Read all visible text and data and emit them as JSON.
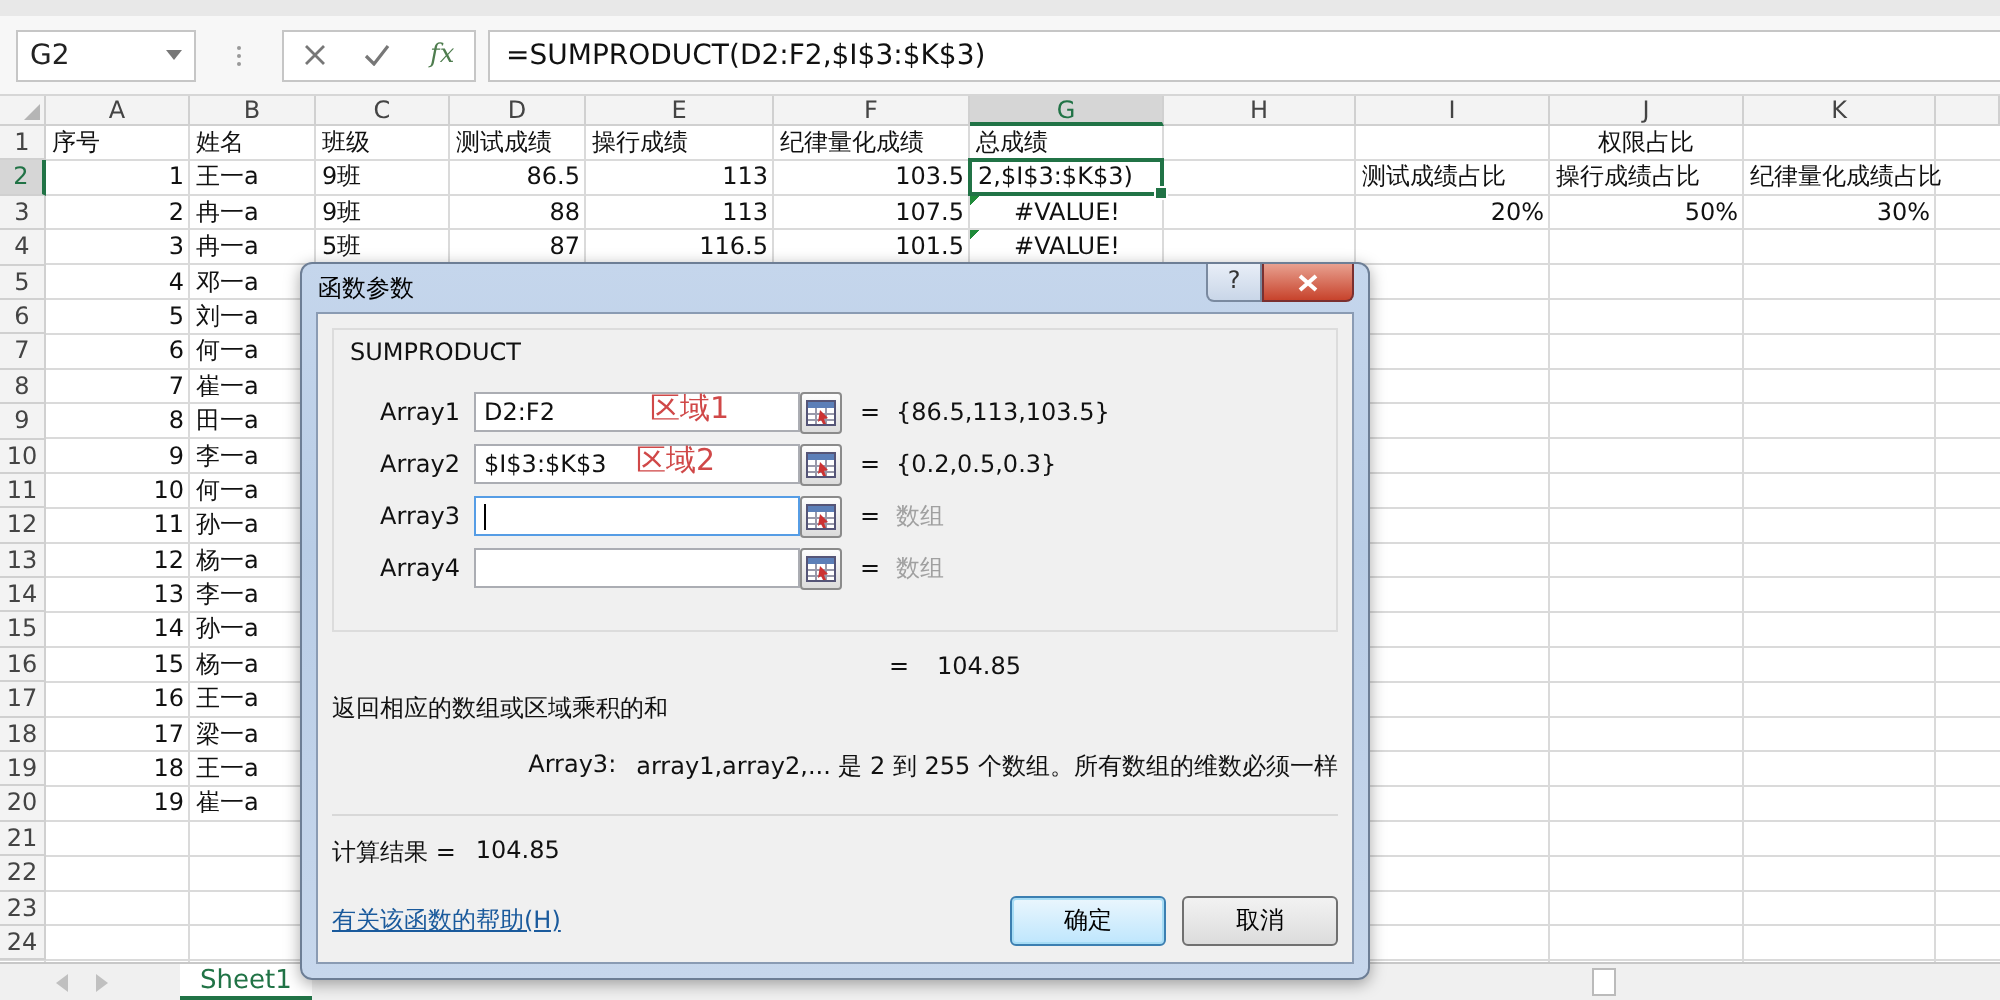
{
  "formula_bar": {
    "name_box": "G2",
    "insert_function": "fx",
    "formula": "=SUMPRODUCT(D2:F2,$I$3:$K$3)"
  },
  "columns": [
    {
      "label": "A",
      "selected": false
    },
    {
      "label": "B",
      "selected": false
    },
    {
      "label": "C",
      "selected": false
    },
    {
      "label": "D",
      "selected": false
    },
    {
      "label": "E",
      "selected": false
    },
    {
      "label": "F",
      "selected": false
    },
    {
      "label": "G",
      "selected": true
    },
    {
      "label": "H",
      "selected": false
    },
    {
      "label": "I",
      "selected": false
    },
    {
      "label": "J",
      "selected": false
    },
    {
      "label": "K",
      "selected": false
    }
  ],
  "rows": [
    {
      "number": "1",
      "selected": false,
      "cells": {
        "A": {
          "text": "序号",
          "kind": "text",
          "active": false,
          "flagged": false
        },
        "B": {
          "text": "姓名",
          "kind": "text",
          "active": false,
          "flagged": false
        },
        "C": {
          "text": "班级",
          "kind": "text",
          "active": false,
          "flagged": false
        },
        "D": {
          "text": "测试成绩",
          "kind": "text",
          "active": false,
          "flagged": false
        },
        "E": {
          "text": "操行成绩",
          "kind": "text",
          "active": false,
          "flagged": false
        },
        "F": {
          "text": "纪律量化成绩",
          "kind": "text",
          "active": false,
          "flagged": false
        },
        "G": {
          "text": "总成绩",
          "kind": "text",
          "active": false,
          "flagged": false
        },
        "I": {
          "text": "权限占比",
          "kind": "merged",
          "active": false,
          "flagged": false
        }
      }
    },
    {
      "number": "2",
      "selected": true,
      "cells": {
        "A": {
          "text": "1",
          "kind": "number",
          "active": false,
          "flagged": false
        },
        "B": {
          "text": "王一a",
          "kind": "text",
          "active": false,
          "flagged": false
        },
        "C": {
          "text": "9班",
          "kind": "text",
          "active": false,
          "flagged": false
        },
        "D": {
          "text": "86.5",
          "kind": "number",
          "active": false,
          "flagged": false
        },
        "E": {
          "text": "113",
          "kind": "number",
          "active": false,
          "flagged": false
        },
        "F": {
          "text": "103.5",
          "kind": "number",
          "active": false,
          "flagged": false
        },
        "G": {
          "text": "2,$I$3:$K$3)",
          "kind": "text",
          "active": true,
          "flagged": false
        },
        "I": {
          "text": "测试成绩占比",
          "kind": "text",
          "active": false,
          "flagged": false
        },
        "J": {
          "text": "操行成绩占比",
          "kind": "text",
          "active": false,
          "flagged": false
        },
        "K": {
          "text": "纪律量化成绩占比",
          "kind": "text",
          "active": false,
          "flagged": false
        }
      }
    },
    {
      "number": "3",
      "selected": false,
      "cells": {
        "A": {
          "text": "2",
          "kind": "number",
          "active": false,
          "flagged": false
        },
        "B": {
          "text": "冉一a",
          "kind": "text",
          "active": false,
          "flagged": false
        },
        "C": {
          "text": "9班",
          "kind": "text",
          "active": false,
          "flagged": false
        },
        "D": {
          "text": "88",
          "kind": "number",
          "active": false,
          "flagged": false
        },
        "E": {
          "text": "113",
          "kind": "number",
          "active": false,
          "flagged": false
        },
        "F": {
          "text": "107.5",
          "kind": "number",
          "active": false,
          "flagged": false
        },
        "G": {
          "text": "#VALUE!",
          "kind": "error",
          "active": false,
          "flagged": true
        },
        "I": {
          "text": "20%",
          "kind": "number",
          "active": false,
          "flagged": false
        },
        "J": {
          "text": "50%",
          "kind": "number",
          "active": false,
          "flagged": false
        },
        "K": {
          "text": "30%",
          "kind": "number",
          "active": false,
          "flagged": false
        }
      }
    },
    {
      "number": "4",
      "selected": false,
      "cells": {
        "A": {
          "text": "3",
          "kind": "number",
          "active": false,
          "flagged": false
        },
        "B": {
          "text": "冉一a",
          "kind": "text",
          "active": false,
          "flagged": false
        },
        "C": {
          "text": "5班",
          "kind": "text",
          "active": false,
          "flagged": false
        },
        "D": {
          "text": "87",
          "kind": "number",
          "active": false,
          "flagged": false
        },
        "E": {
          "text": "116.5",
          "kind": "number",
          "active": false,
          "flagged": false
        },
        "F": {
          "text": "101.5",
          "kind": "number",
          "active": false,
          "flagged": false
        },
        "G": {
          "text": "#VALUE!",
          "kind": "error",
          "active": false,
          "flagged": true
        }
      }
    },
    {
      "number": "5",
      "selected": false,
      "cells": {
        "A": {
          "text": "4",
          "kind": "number",
          "active": false,
          "flagged": false
        },
        "B": {
          "text": "邓一a",
          "kind": "text",
          "active": false,
          "flagged": false
        }
      }
    },
    {
      "number": "6",
      "selected": false,
      "cells": {
        "A": {
          "text": "5",
          "kind": "number",
          "active": false,
          "flagged": false
        },
        "B": {
          "text": "刘一a",
          "kind": "text",
          "active": false,
          "flagged": false
        }
      }
    },
    {
      "number": "7",
      "selected": false,
      "cells": {
        "A": {
          "text": "6",
          "kind": "number",
          "active": false,
          "flagged": false
        },
        "B": {
          "text": "何一a",
          "kind": "text",
          "active": false,
          "flagged": false
        }
      }
    },
    {
      "number": "8",
      "selected": false,
      "cells": {
        "A": {
          "text": "7",
          "kind": "number",
          "active": false,
          "flagged": false
        },
        "B": {
          "text": "崔一a",
          "kind": "text",
          "active": false,
          "flagged": false
        }
      }
    },
    {
      "number": "9",
      "selected": false,
      "cells": {
        "A": {
          "text": "8",
          "kind": "number",
          "active": false,
          "flagged": false
        },
        "B": {
          "text": "田一a",
          "kind": "text",
          "active": false,
          "flagged": false
        }
      }
    },
    {
      "number": "10",
      "selected": false,
      "cells": {
        "A": {
          "text": "9",
          "kind": "number",
          "active": false,
          "flagged": false
        },
        "B": {
          "text": "李一a",
          "kind": "text",
          "active": false,
          "flagged": false
        }
      }
    },
    {
      "number": "11",
      "selected": false,
      "cells": {
        "A": {
          "text": "10",
          "kind": "number",
          "active": false,
          "flagged": false
        },
        "B": {
          "text": "何一a",
          "kind": "text",
          "active": false,
          "flagged": false
        }
      }
    },
    {
      "number": "12",
      "selected": false,
      "cells": {
        "A": {
          "text": "11",
          "kind": "number",
          "active": false,
          "flagged": false
        },
        "B": {
          "text": "孙一a",
          "kind": "text",
          "active": false,
          "flagged": false
        }
      }
    },
    {
      "number": "13",
      "selected": false,
      "cells": {
        "A": {
          "text": "12",
          "kind": "number",
          "active": false,
          "flagged": false
        },
        "B": {
          "text": "杨一a",
          "kind": "text",
          "active": false,
          "flagged": false
        }
      }
    },
    {
      "number": "14",
      "selected": false,
      "cells": {
        "A": {
          "text": "13",
          "kind": "number",
          "active": false,
          "flagged": false
        },
        "B": {
          "text": "李一a",
          "kind": "text",
          "active": false,
          "flagged": false
        }
      }
    },
    {
      "number": "15",
      "selected": false,
      "cells": {
        "A": {
          "text": "14",
          "kind": "number",
          "active": false,
          "flagged": false
        },
        "B": {
          "text": "孙一a",
          "kind": "text",
          "active": false,
          "flagged": false
        }
      }
    },
    {
      "number": "16",
      "selected": false,
      "cells": {
        "A": {
          "text": "15",
          "kind": "number",
          "active": false,
          "flagged": false
        },
        "B": {
          "text": "杨一a",
          "kind": "text",
          "active": false,
          "flagged": false
        }
      }
    },
    {
      "number": "17",
      "selected": false,
      "cells": {
        "A": {
          "text": "16",
          "kind": "number",
          "active": false,
          "flagged": false
        },
        "B": {
          "text": "王一a",
          "kind": "text",
          "active": false,
          "flagged": false
        }
      }
    },
    {
      "number": "18",
      "selected": false,
      "cells": {
        "A": {
          "text": "17",
          "kind": "number",
          "active": false,
          "flagged": false
        },
        "B": {
          "text": "梁一a",
          "kind": "text",
          "active": false,
          "flagged": false
        }
      }
    },
    {
      "number": "19",
      "selected": false,
      "cells": {
        "A": {
          "text": "18",
          "kind": "number",
          "active": false,
          "flagged": false
        },
        "B": {
          "text": "王一a",
          "kind": "text",
          "active": false,
          "flagged": false
        }
      }
    },
    {
      "number": "20",
      "selected": false,
      "cells": {
        "A": {
          "text": "19",
          "kind": "number",
          "active": false,
          "flagged": false
        },
        "B": {
          "text": "崔一a",
          "kind": "text",
          "active": false,
          "flagged": false
        }
      }
    },
    {
      "number": "21",
      "selected": false
    },
    {
      "number": "22",
      "selected": false
    },
    {
      "number": "23",
      "selected": false
    },
    {
      "number": "24",
      "selected": false
    }
  ],
  "sheet_tabs": [
    {
      "label": "Sheet1",
      "selected": true
    }
  ],
  "dialog": {
    "title": "函数参数",
    "help_button": "?",
    "function_name": "SUMPRODUCT",
    "arguments": [
      {
        "label": "Array1",
        "value": "D2:F2",
        "equals": "=",
        "result": "{86.5,113,103.5}",
        "dimmed": false,
        "focused": false,
        "annotation": "区域1"
      },
      {
        "label": "Array2",
        "value": "$I$3:$K$3",
        "equals": "=",
        "result": "{0.2,0.5,0.3}",
        "dimmed": false,
        "focused": false,
        "annotation": "区域2"
      },
      {
        "label": "Array3",
        "equals": "=",
        "result": "数组",
        "dimmed": true,
        "focused": true
      },
      {
        "label": "Array4",
        "equals": "=",
        "result": "数组",
        "dimmed": true,
        "focused": false
      }
    ],
    "formula_result_equals": "=",
    "formula_result": "104.85",
    "description": "返回相应的数组或区域乘积的和",
    "argument_help_label": "Array3:",
    "argument_help": "array1,array2,... 是 2 到 255 个数组。所有数组的维数必须一样",
    "calc_result_label": "计算结果 =",
    "calc_result": "104.85",
    "help_link": "有关该函数的帮助(H)",
    "buttons": [
      {
        "label": "确定",
        "default": true
      },
      {
        "label": "取消",
        "default": false
      }
    ]
  }
}
